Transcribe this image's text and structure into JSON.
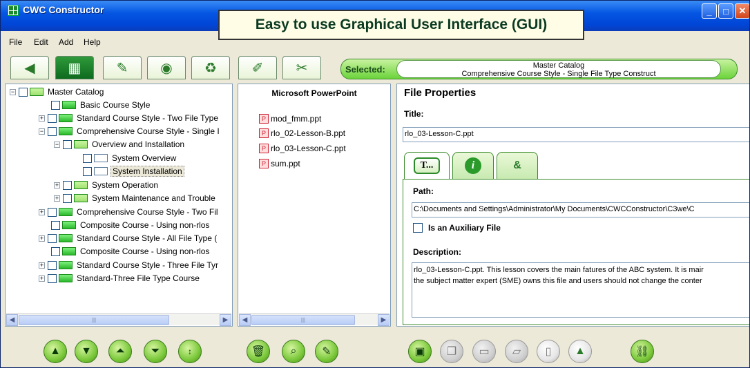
{
  "window": {
    "title": "CWC Constructor",
    "banner": "Easy to use Graphical User Interface (GUI)"
  },
  "menu": [
    "File",
    "Edit",
    "Add",
    "Help"
  ],
  "toolbar": {
    "tabs": [
      "back-icon",
      "tree-view-icon",
      "checklist-icon",
      "preview-eye-icon",
      "recycle-icon",
      "edit-folder-icon",
      "tools-icon"
    ],
    "active_tab_index": 1,
    "selected_label": "Selected:",
    "selected_line1": "Master Catalog",
    "selected_line2": "Comprehensive Course Style - Single File Type Construct"
  },
  "tree": {
    "items": [
      {
        "label": "Master Catalog"
      },
      {
        "label": "Basic Course Style"
      },
      {
        "label": "Standard Course Style - Two File Type"
      },
      {
        "label": "Comprehensive Course Style - Single I"
      },
      {
        "label": "Overview and Installation"
      },
      {
        "label": "System Overview"
      },
      {
        "label": "System Installation"
      },
      {
        "label": "System Operation"
      },
      {
        "label": "System Maintenance and Trouble"
      },
      {
        "label": "Comprehensive Course Style - Two Fil"
      },
      {
        "label": "Composite Course - Using non-rlos"
      },
      {
        "label": "Standard Course Style - All File Type ("
      },
      {
        "label": "Composite Course - Using non-rlos"
      },
      {
        "label": "Standard Course Style - Three File Tyr"
      },
      {
        "label": "Standard-Three File Type Course"
      }
    ]
  },
  "files": {
    "header": "Microsoft PowerPoint",
    "items": [
      "mod_fmm.ppt",
      "rlo_02-Lesson-B.ppt",
      "rlo_03-Lesson-C.ppt",
      "sum.ppt"
    ]
  },
  "props": {
    "heading": "File Properties",
    "title_label": "Title:",
    "title_value": "rlo_03-Lesson-C.ppt",
    "subtabs": [
      "T...",
      "i",
      "&"
    ],
    "path_label": "Path:",
    "path_value": "C:\\Documents and Settings\\Administrator\\My Documents\\CWCConstructor\\C3we\\C",
    "aux_label": "Is an Auxiliary File",
    "aux_checked": false,
    "desc_label": "Description:",
    "desc_line1": "rlo_03-Lesson-C.ppt. This lesson covers the main fatures of the ABC system. It is mair",
    "desc_line2": "the subject matter expert (SME) owns this file and users should not change the conter"
  },
  "bottom": {
    "group1": [
      "move-up-icon",
      "move-down-icon",
      "move-top-icon",
      "move-bottom-icon",
      "sort-az-icon"
    ],
    "group2": [
      "delete-trash-icon",
      "find-binoculars-icon",
      "edit-pen-icon"
    ],
    "group3": [
      "package-icon",
      "copy-icon",
      "folder-icon",
      "open-folder-icon",
      "new-page-icon",
      "export-page-icon"
    ],
    "group4": [
      "link-chain-icon"
    ]
  },
  "colors": {
    "titlebar": "#0556E3",
    "accent_green": "#6bd33a",
    "chrome": "#ECE9D8"
  }
}
